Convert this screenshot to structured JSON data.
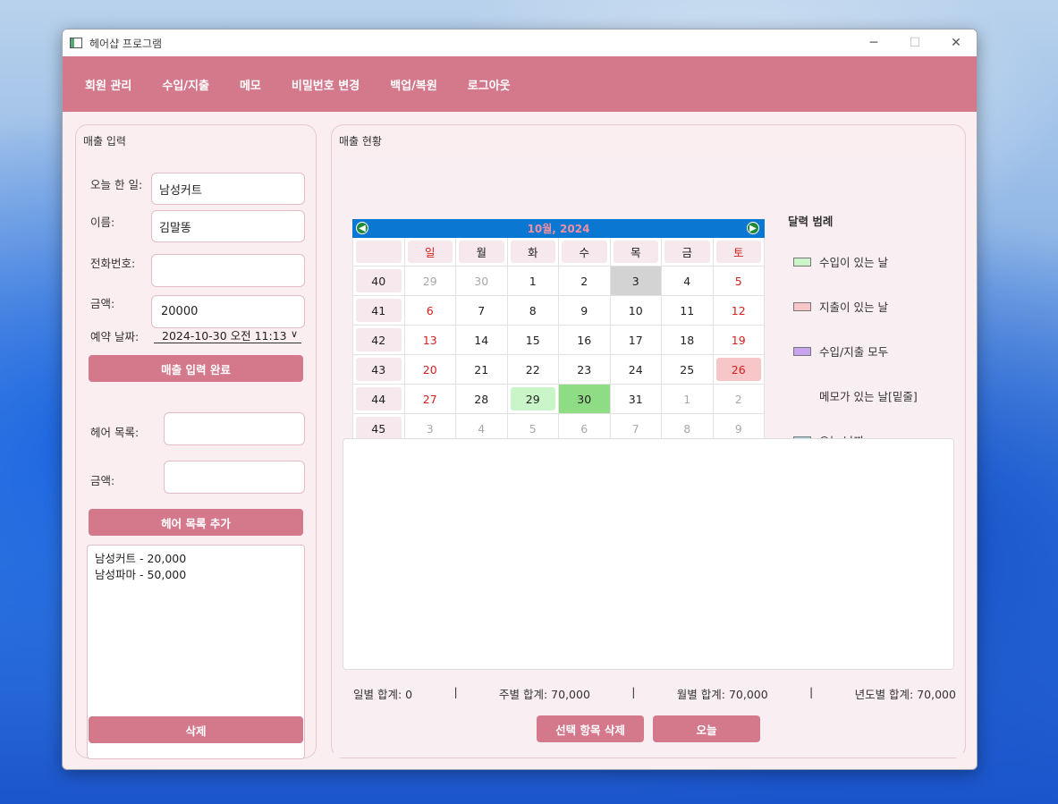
{
  "window": {
    "title": "헤어샵 프로그램"
  },
  "menu": [
    "회원 관리",
    "수입/지출",
    "메모",
    "비밀번호 변경",
    "백업/복원",
    "로그아웃"
  ],
  "left_panel": {
    "title": "매출 입력",
    "today_work_label": "오늘 한 일:",
    "today_work_value": "남성커트",
    "name_label": "이름:",
    "name_value": "김말똥",
    "phone_label": "전화번호:",
    "phone_value": "",
    "amount_label": "금액:",
    "amount_value": "20000",
    "date_label": "예약 날짜:",
    "date_value": "2024-10-30 오전 11:13",
    "submit_button": "매출 입력 완료",
    "hair_list_label": "헤어 목록:",
    "hair_list_value": "",
    "hair_amount_label": "금액:",
    "hair_amount_value": "",
    "add_button": "헤어 목록 추가",
    "list_items": [
      "남성커트 - 20,000",
      "남성파마 - 50,000"
    ],
    "delete_button": "삭제"
  },
  "right_panel": {
    "title": "매출 현황",
    "calendar": {
      "title": "10월, 2024",
      "weekdays": [
        "일",
        "월",
        "화",
        "수",
        "목",
        "금",
        "토"
      ],
      "weeks": [
        {
          "wk": "40",
          "days": [
            "29",
            "30",
            "1",
            "2",
            "3",
            "4",
            "5"
          ]
        },
        {
          "wk": "41",
          "days": [
            "6",
            "7",
            "8",
            "9",
            "10",
            "11",
            "12"
          ]
        },
        {
          "wk": "42",
          "days": [
            "13",
            "14",
            "15",
            "16",
            "17",
            "18",
            "19"
          ]
        },
        {
          "wk": "43",
          "days": [
            "20",
            "21",
            "22",
            "23",
            "24",
            "25",
            "26"
          ]
        },
        {
          "wk": "44",
          "days": [
            "27",
            "28",
            "29",
            "30",
            "31",
            "1",
            "2"
          ]
        },
        {
          "wk": "45",
          "days": [
            "3",
            "4",
            "5",
            "6",
            "7",
            "8",
            "9"
          ]
        }
      ]
    },
    "legend": {
      "title": "달력 범례",
      "items": [
        {
          "label": "수입이 있는 날",
          "color": "#c9f5c9"
        },
        {
          "label": "지출이 있는 날",
          "color": "#f6c6c8"
        },
        {
          "label": "수입/지출 모두",
          "color": "#c7a3f0"
        },
        {
          "label": "메모가 있는 날[밑줄]",
          "color": ""
        },
        {
          "label": "오늘 날짜",
          "color": "#a8d8e0"
        }
      ]
    },
    "totals": {
      "daily": "일별 합계: 0",
      "weekly": "주별 합계: 70,000",
      "monthly": "월별 합계: 70,000",
      "yearly": "년도별 합계: 70,000",
      "sep": "|"
    },
    "delete_selected_button": "선택 항목 삭제",
    "today_button": "오늘"
  }
}
